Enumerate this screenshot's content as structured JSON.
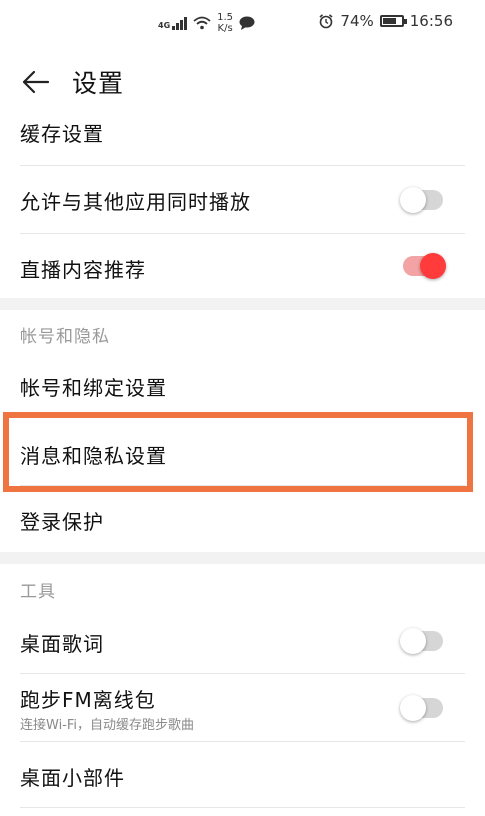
{
  "status_bar": {
    "net_type": "4G",
    "speed_value": "1.5",
    "speed_unit": "K/s",
    "battery": "74%",
    "battery_level": 0.74,
    "time": "16:56"
  },
  "header": {
    "title": "设置"
  },
  "rows": {
    "cache": "缓存设置",
    "allow_play": "允许与其他应用同时播放",
    "live_recommend": "直播内容推荐",
    "account_binding": "帐号和绑定设置",
    "message_privacy": "消息和隐私设置",
    "login_protect": "登录保护",
    "desktop_lyrics": "桌面歌词",
    "running_fm": "跑步FM离线包",
    "running_fm_sub": "连接Wi-Fi，自动缓存跑步歌曲",
    "desktop_widget": "桌面小部件"
  },
  "sections": {
    "account_privacy": "帐号和隐私",
    "tools": "工具"
  },
  "toggles": {
    "allow_play": false,
    "live_recommend": true,
    "desktop_lyrics": false,
    "running_fm": false
  },
  "colors": {
    "accent": "#ff3b3b",
    "highlight_border": "#f07442"
  }
}
